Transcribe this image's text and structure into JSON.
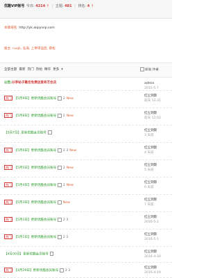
{
  "header": {
    "forum_name": "优酷VIP账号",
    "today_label": "今日:",
    "today_value": "4214",
    "topics_label": "主题:",
    "topics_value": "481",
    "rank_label": "排名:",
    "rank_value": "4"
  },
  "info": {
    "url_label": "本版域名:",
    "url_value": "http://yk.aiqiyivip.com",
    "mods_label": "版主:",
    "mods_value": "ruojk, 泓海, 上帝审运后, 蔡松"
  },
  "toolbar": {
    "filters": [
      "全部主题",
      "最新",
      "热门",
      "热帖",
      "精华",
      "更多"
    ],
    "newwin_label": "新窗",
    "author_label": "作者"
  },
  "threads": [
    {
      "type": "announce",
      "label": "公告:",
      "title": "分享帖子最佳免费送爱奇艺会员",
      "author": "admin",
      "date": "2015-5-7"
    },
    {
      "hot": "热门",
      "tag": "【5月9日】",
      "title": "更新优酷会员账号",
      "pages": "2",
      "new": "New",
      "author": "红尘洞影",
      "date": "前天 12:31"
    },
    {
      "hot": "热门",
      "tag": "【5月8日】",
      "title": "更新优酷会员账号",
      "pages": "2",
      "new": "New",
      "author": "红尘洞影",
      "date": "前天 12:02"
    },
    {
      "hot": "",
      "tag": "【5月7日】",
      "title": "更新优酷会员账号",
      "pages": "",
      "new": "",
      "author": "红尘洞影",
      "date": "3 天前"
    },
    {
      "hot": "热门",
      "tag": "【5月6日】",
      "title": "更新优酷会员账号",
      "pages": "2 3",
      "new": "New",
      "author": "红尘洞影",
      "date": "4 天前"
    },
    {
      "hot": "热门",
      "tag": "【5月5日】",
      "title": "更新优酷会员账号",
      "pages": "2",
      "new": "New",
      "author": "红尘洞影",
      "date": "5 天前"
    },
    {
      "hot": "热门",
      "tag": "【5月4日】",
      "title": "更新优酷会员账号",
      "pages": "2",
      "new": "New",
      "author": "红尘洞影",
      "date": "6 天前"
    },
    {
      "hot": "热门",
      "tag": "【5月3日】",
      "title": "更新优酷会员账号",
      "pages": "",
      "new": "New",
      "author": "红尘洞影",
      "date": "7 天前"
    },
    {
      "hot": "热门",
      "tag": "【5月2日】",
      "title": "更新优酷会员账号",
      "pages": "2 3",
      "new": "",
      "author": "红尘洞影",
      "date": "2016-5-2"
    },
    {
      "hot": "热门",
      "tag": "【5月1日】",
      "title": "更新优酷会员账号",
      "pages": "2 3",
      "new": "",
      "author": "红尘洞影",
      "date": "2016-5-1"
    },
    {
      "hot": "",
      "tag": "【4月30日】",
      "title": "更新优酷会员账号",
      "pages": "",
      "new": "",
      "author": "红尘洞影",
      "date": "2016-4-30"
    },
    {
      "hot": "热门",
      "tag": "【4月29日】",
      "title": "更新优酷会员账号",
      "pages": "2 3",
      "new": "",
      "author": "红尘洞影",
      "date": "2016-4-29"
    }
  ]
}
